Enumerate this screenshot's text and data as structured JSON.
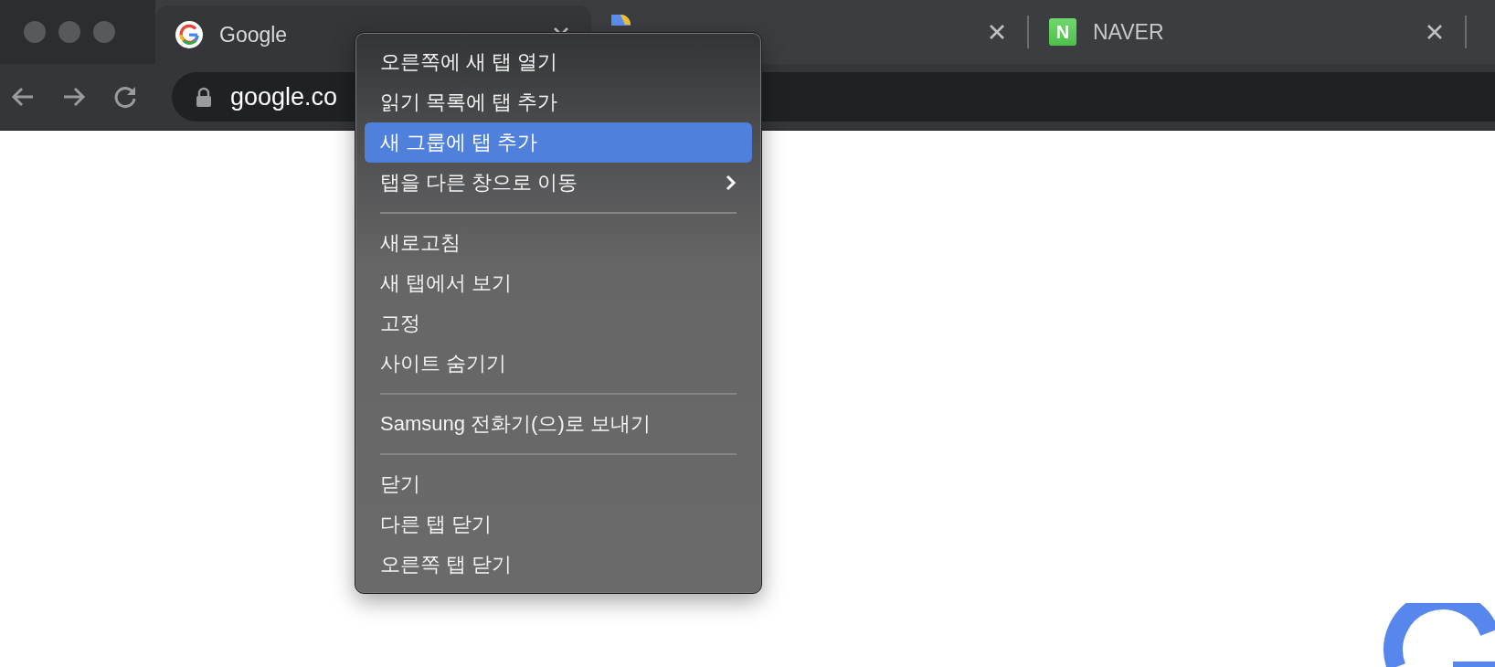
{
  "tabs": [
    {
      "title": "Google",
      "selected": true,
      "kind": "g-circle"
    },
    {
      "selected": false,
      "kind": "d-shape"
    },
    {
      "title": "NAVER",
      "selected": false,
      "kind": "letter-square",
      "favicon_letter": "N"
    }
  ],
  "address_bar": {
    "value": "google.co"
  },
  "context_menu": {
    "items": [
      {
        "kind": "item",
        "label": "오른쪽에 새 탭 열기",
        "selected": false,
        "has_submenu": false
      },
      {
        "kind": "item",
        "label": "읽기 목록에 탭 추가",
        "selected": false,
        "has_submenu": false
      },
      {
        "kind": "item",
        "label": "새 그룹에 탭 추가",
        "selected": true,
        "has_submenu": false
      },
      {
        "kind": "item",
        "label": "탭을 다른 창으로 이동",
        "selected": false,
        "has_submenu": true
      },
      {
        "kind": "separator"
      },
      {
        "kind": "item",
        "label": "새로고침",
        "selected": false,
        "has_submenu": false
      },
      {
        "kind": "item",
        "label": "새 탭에서 보기",
        "selected": false,
        "has_submenu": false
      },
      {
        "kind": "item",
        "label": "고정",
        "selected": false,
        "has_submenu": false
      },
      {
        "kind": "item",
        "label": "사이트 숨기기",
        "selected": false,
        "has_submenu": false
      },
      {
        "kind": "separator"
      },
      {
        "kind": "item",
        "label": "Samsung 전화기(으)로 보내기",
        "selected": false,
        "has_submenu": false
      },
      {
        "kind": "separator"
      },
      {
        "kind": "item",
        "label": "닫기",
        "selected": false,
        "has_submenu": false
      },
      {
        "kind": "item",
        "label": "다른 탭 닫기",
        "selected": false,
        "has_submenu": false
      },
      {
        "kind": "item",
        "label": "오른쪽 탭 닫기",
        "selected": false,
        "has_submenu": false
      }
    ]
  }
}
